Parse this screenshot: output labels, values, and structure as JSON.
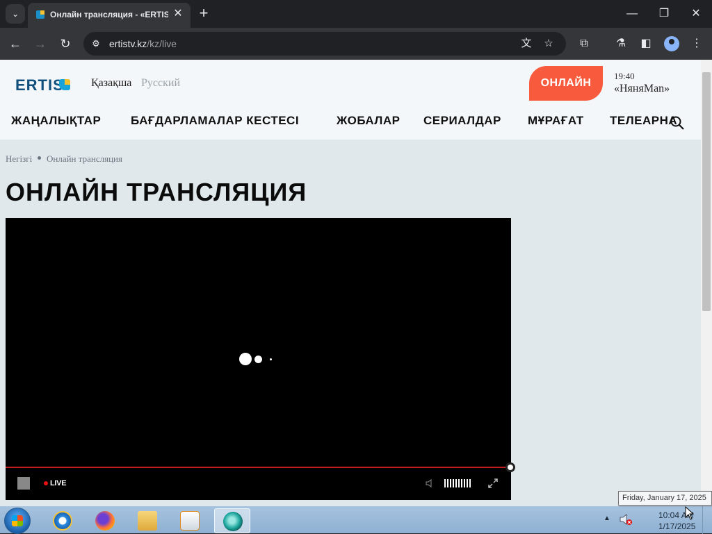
{
  "browser": {
    "tab_title": "Онлайн трансляция - «ERTIS»",
    "url_host": "ertistv.kz",
    "url_path": "/kz/live",
    "new_tab": "+",
    "close_tab": "✕"
  },
  "site": {
    "logo": "ERTIS",
    "languages": [
      "Қазақша",
      "Русский"
    ],
    "live_button": "ОНЛАЙН",
    "now_playing": {
      "time": "19:40",
      "show": "«НяняМan»"
    },
    "nav": [
      "ЖАҢАЛЫҚТАР",
      "БАҒДАРЛАМАЛАР КЕСТЕСІ",
      "ЖОБАЛАР",
      "СЕРИАЛДАР",
      "МҰРАҒАТ",
      "ТЕЛЕАРНА"
    ],
    "breadcrumb": {
      "home": "Негізгі",
      "current": "Онлайн трансляция"
    },
    "page_title": "ОНЛАЙН ТРАНСЛЯЦИЯ"
  },
  "player": {
    "live_label": "LIVE",
    "progress_fraction": 1.0,
    "colors": {
      "progress": "#c31d1d",
      "live_dot": "#ee1111"
    }
  },
  "taskbar": {
    "clock_time": "10:04 AM",
    "clock_date": "1/17/2025",
    "tooltip": "Friday, January 17, 2025"
  },
  "colors": {
    "accent": "#f75a3d",
    "brand": "#0e4f7e"
  }
}
